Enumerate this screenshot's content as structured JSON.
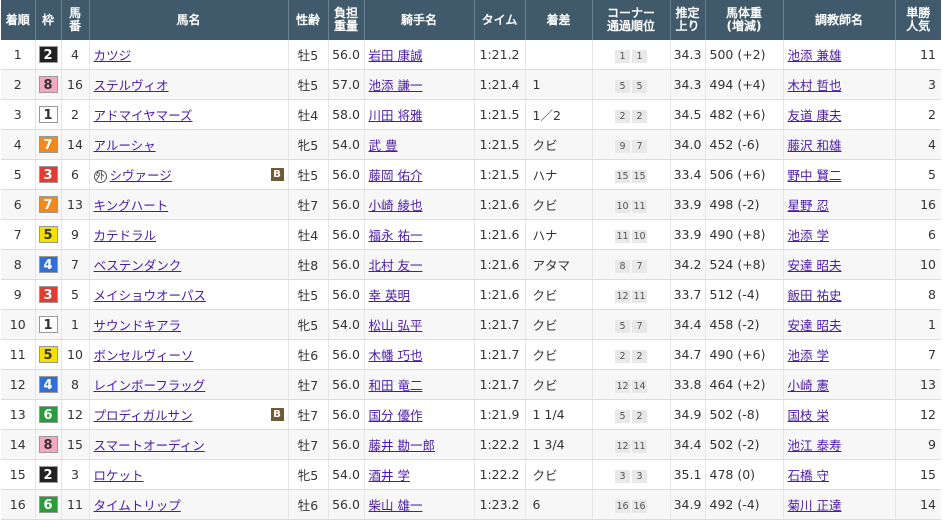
{
  "headers": {
    "rank": "着順",
    "waku": "枠",
    "umaban_top": "馬",
    "umaban_bottom": "番",
    "horse": "馬名",
    "sexage": "性齢",
    "weight_top": "負担",
    "weight_bottom": "重量",
    "jockey": "騎手名",
    "time": "タイム",
    "margin": "着差",
    "corner_top": "コーナー",
    "corner_bottom": "通過順位",
    "agari_top": "推定",
    "agari_bottom": "上り",
    "body_top": "馬体重",
    "body_bottom": "(増減)",
    "trainer": "調教師名",
    "pop_top": "単勝",
    "pop_bottom": "人気"
  },
  "waku_colors": {
    "1": {
      "bg": "#ffffff",
      "fg": "#333333"
    },
    "2": {
      "bg": "#222222",
      "fg": "#ffffff"
    },
    "3": {
      "bg": "#e03c31",
      "fg": "#ffffff"
    },
    "4": {
      "bg": "#2f6fd6",
      "fg": "#ffffff"
    },
    "5": {
      "bg": "#f5e000",
      "fg": "#333333"
    },
    "6": {
      "bg": "#2e9a3e",
      "fg": "#ffffff"
    },
    "7": {
      "bg": "#f08a1c",
      "fg": "#ffffff"
    },
    "8": {
      "bg": "#f5a6c2",
      "fg": "#333333"
    }
  },
  "rows": [
    {
      "rank": "1",
      "waku": "2",
      "umaban": "4",
      "horse": "カツジ",
      "foreign": false,
      "blinker": false,
      "sexage": "牡5",
      "weight": "56.0",
      "jockey": "岩田 康誠",
      "time": "1:21.2",
      "margin": "",
      "corner": [
        "1",
        "1"
      ],
      "agari": "34.3",
      "body": "500 (+2)",
      "trainer": "池添 兼雄",
      "pop": "11"
    },
    {
      "rank": "2",
      "waku": "8",
      "umaban": "16",
      "horse": "ステルヴィオ",
      "foreign": false,
      "blinker": false,
      "sexage": "牡5",
      "weight": "57.0",
      "jockey": "池添 謙一",
      "time": "1:21.4",
      "margin": "1",
      "corner": [
        "5",
        "5"
      ],
      "agari": "34.3",
      "body": "494 (+4)",
      "trainer": "木村 哲也",
      "pop": "3"
    },
    {
      "rank": "3",
      "waku": "1",
      "umaban": "2",
      "horse": "アドマイヤマーズ",
      "foreign": false,
      "blinker": false,
      "sexage": "牡4",
      "weight": "58.0",
      "jockey": "川田 将雅",
      "time": "1:21.5",
      "margin": "1／2",
      "corner": [
        "2",
        "2"
      ],
      "agari": "34.5",
      "body": "482 (+6)",
      "trainer": "友道 康夫",
      "pop": "2"
    },
    {
      "rank": "4",
      "waku": "7",
      "umaban": "14",
      "horse": "アルーシャ",
      "foreign": false,
      "blinker": false,
      "sexage": "牝5",
      "weight": "54.0",
      "jockey": "武 豊",
      "time": "1:21.5",
      "margin": "クビ",
      "corner": [
        "9",
        "7"
      ],
      "agari": "34.0",
      "body": "452 (-6)",
      "trainer": "藤沢 和雄",
      "pop": "4"
    },
    {
      "rank": "5",
      "waku": "3",
      "umaban": "6",
      "horse": "シヴァージ",
      "foreign": true,
      "foreign_mark": "外",
      "blinker": true,
      "blinker_mark": "B",
      "sexage": "牡5",
      "weight": "56.0",
      "jockey": "藤岡 佑介",
      "time": "1:21.5",
      "margin": "ハナ",
      "corner": [
        "15",
        "15"
      ],
      "agari": "33.4",
      "body": "506 (+6)",
      "trainer": "野中 賢二",
      "pop": "5"
    },
    {
      "rank": "6",
      "waku": "7",
      "umaban": "13",
      "horse": "キングハート",
      "foreign": false,
      "blinker": false,
      "sexage": "牡7",
      "weight": "56.0",
      "jockey": "小崎 綾也",
      "time": "1:21.6",
      "margin": "クビ",
      "corner": [
        "10",
        "11"
      ],
      "agari": "33.9",
      "body": "498 (-2)",
      "trainer": "星野 忍",
      "pop": "16"
    },
    {
      "rank": "7",
      "waku": "5",
      "umaban": "9",
      "horse": "カテドラル",
      "foreign": false,
      "blinker": false,
      "sexage": "牡4",
      "weight": "56.0",
      "jockey": "福永 祐一",
      "time": "1:21.6",
      "margin": "ハナ",
      "corner": [
        "11",
        "10"
      ],
      "agari": "33.9",
      "body": "490 (+8)",
      "trainer": "池添 学",
      "pop": "6"
    },
    {
      "rank": "8",
      "waku": "4",
      "umaban": "7",
      "horse": "ベステンダンク",
      "foreign": false,
      "blinker": false,
      "sexage": "牡8",
      "weight": "56.0",
      "jockey": "北村 友一",
      "time": "1:21.6",
      "margin": "アタマ",
      "corner": [
        "8",
        "7"
      ],
      "agari": "34.2",
      "body": "524 (+8)",
      "trainer": "安達 昭夫",
      "pop": "10"
    },
    {
      "rank": "9",
      "waku": "3",
      "umaban": "5",
      "horse": "メイショウオーパス",
      "foreign": false,
      "blinker": false,
      "sexage": "牡5",
      "weight": "56.0",
      "jockey": "幸 英明",
      "time": "1:21.6",
      "margin": "クビ",
      "corner": [
        "12",
        "11"
      ],
      "agari": "33.7",
      "body": "512 (-4)",
      "trainer": "飯田 祐史",
      "pop": "8"
    },
    {
      "rank": "10",
      "waku": "1",
      "umaban": "1",
      "horse": "サウンドキアラ",
      "foreign": false,
      "blinker": false,
      "sexage": "牝5",
      "weight": "54.0",
      "jockey": "松山 弘平",
      "time": "1:21.7",
      "margin": "クビ",
      "corner": [
        "5",
        "7"
      ],
      "agari": "34.4",
      "body": "458 (-2)",
      "trainer": "安達 昭夫",
      "pop": "1"
    },
    {
      "rank": "11",
      "waku": "5",
      "umaban": "10",
      "horse": "ボンセルヴィーソ",
      "foreign": false,
      "blinker": false,
      "sexage": "牡6",
      "weight": "56.0",
      "jockey": "木幡 巧也",
      "time": "1:21.7",
      "margin": "クビ",
      "corner": [
        "2",
        "2"
      ],
      "agari": "34.7",
      "body": "490 (+6)",
      "trainer": "池添 学",
      "pop": "7"
    },
    {
      "rank": "12",
      "waku": "4",
      "umaban": "8",
      "horse": "レインボーフラッグ",
      "foreign": false,
      "blinker": false,
      "sexage": "牡7",
      "weight": "56.0",
      "jockey": "和田 竜二",
      "time": "1:21.7",
      "margin": "クビ",
      "corner": [
        "12",
        "14"
      ],
      "agari": "33.8",
      "body": "464 (+2)",
      "trainer": "小崎 憲",
      "pop": "13"
    },
    {
      "rank": "13",
      "waku": "6",
      "umaban": "12",
      "horse": "プロディガルサン",
      "foreign": false,
      "blinker": true,
      "blinker_mark": "B",
      "sexage": "牡7",
      "weight": "56.0",
      "jockey": "国分 優作",
      "time": "1:21.9",
      "margin": "1 1/4",
      "corner": [
        "5",
        "2"
      ],
      "agari": "34.9",
      "body": "502 (-8)",
      "trainer": "国枝 栄",
      "pop": "12"
    },
    {
      "rank": "14",
      "waku": "8",
      "umaban": "15",
      "horse": "スマートオーディン",
      "foreign": false,
      "blinker": false,
      "sexage": "牡7",
      "weight": "56.0",
      "jockey": "藤井 勘一郎",
      "time": "1:22.2",
      "margin": "1 3/4",
      "corner": [
        "12",
        "11"
      ],
      "agari": "34.4",
      "body": "502 (-2)",
      "trainer": "池江 泰寿",
      "pop": "9"
    },
    {
      "rank": "15",
      "waku": "2",
      "umaban": "3",
      "horse": "ロケット",
      "foreign": false,
      "blinker": false,
      "sexage": "牝5",
      "weight": "54.0",
      "jockey": "酒井 学",
      "time": "1:22.2",
      "margin": "クビ",
      "corner": [
        "3",
        "3"
      ],
      "agari": "35.1",
      "body": "478 (0)",
      "trainer": "石橋 守",
      "pop": "15"
    },
    {
      "rank": "16",
      "waku": "6",
      "umaban": "11",
      "horse": "タイムトリップ",
      "foreign": false,
      "blinker": false,
      "sexage": "牡6",
      "weight": "56.0",
      "jockey": "柴山 雄一",
      "time": "1:23.2",
      "margin": "6",
      "corner": [
        "16",
        "16"
      ],
      "agari": "34.9",
      "body": "492 (-4)",
      "trainer": "菊川 正達",
      "pop": "14"
    }
  ]
}
